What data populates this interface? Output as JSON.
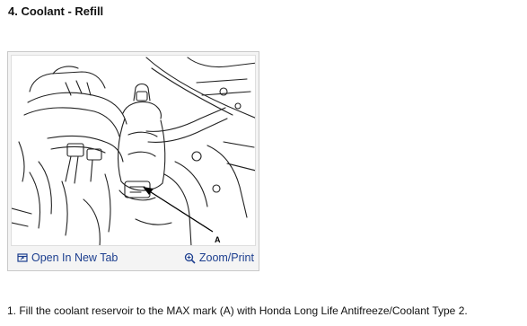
{
  "section": {
    "title": "4. Coolant - Refill"
  },
  "figure": {
    "callout_label": "A",
    "open_tab_label": "Open In New Tab",
    "zoom_print_label": "Zoom/Print",
    "accent_color": "#1d3f8f",
    "icons": {
      "open_tab": "open-new-tab-icon",
      "zoom": "zoom-icon"
    }
  },
  "instructions": [
    {
      "text": "1. Fill the coolant reservoir to the MAX mark (A) with Honda Long Life Antifreeze/Coolant Type 2."
    }
  ]
}
